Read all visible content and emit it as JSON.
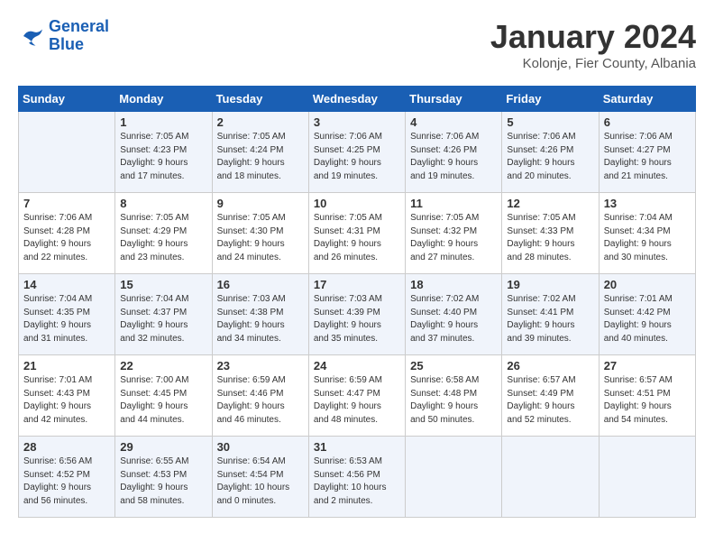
{
  "header": {
    "logo_line1": "General",
    "logo_line2": "Blue",
    "title": "January 2024",
    "subtitle": "Kolonje, Fier County, Albania"
  },
  "days_of_week": [
    "Sunday",
    "Monday",
    "Tuesday",
    "Wednesday",
    "Thursday",
    "Friday",
    "Saturday"
  ],
  "weeks": [
    [
      {
        "day": "",
        "info": ""
      },
      {
        "day": "1",
        "info": "Sunrise: 7:05 AM\nSunset: 4:23 PM\nDaylight: 9 hours\nand 17 minutes."
      },
      {
        "day": "2",
        "info": "Sunrise: 7:05 AM\nSunset: 4:24 PM\nDaylight: 9 hours\nand 18 minutes."
      },
      {
        "day": "3",
        "info": "Sunrise: 7:06 AM\nSunset: 4:25 PM\nDaylight: 9 hours\nand 19 minutes."
      },
      {
        "day": "4",
        "info": "Sunrise: 7:06 AM\nSunset: 4:26 PM\nDaylight: 9 hours\nand 19 minutes."
      },
      {
        "day": "5",
        "info": "Sunrise: 7:06 AM\nSunset: 4:26 PM\nDaylight: 9 hours\nand 20 minutes."
      },
      {
        "day": "6",
        "info": "Sunrise: 7:06 AM\nSunset: 4:27 PM\nDaylight: 9 hours\nand 21 minutes."
      }
    ],
    [
      {
        "day": "7",
        "info": "Sunrise: 7:06 AM\nSunset: 4:28 PM\nDaylight: 9 hours\nand 22 minutes."
      },
      {
        "day": "8",
        "info": "Sunrise: 7:05 AM\nSunset: 4:29 PM\nDaylight: 9 hours\nand 23 minutes."
      },
      {
        "day": "9",
        "info": "Sunrise: 7:05 AM\nSunset: 4:30 PM\nDaylight: 9 hours\nand 24 minutes."
      },
      {
        "day": "10",
        "info": "Sunrise: 7:05 AM\nSunset: 4:31 PM\nDaylight: 9 hours\nand 26 minutes."
      },
      {
        "day": "11",
        "info": "Sunrise: 7:05 AM\nSunset: 4:32 PM\nDaylight: 9 hours\nand 27 minutes."
      },
      {
        "day": "12",
        "info": "Sunrise: 7:05 AM\nSunset: 4:33 PM\nDaylight: 9 hours\nand 28 minutes."
      },
      {
        "day": "13",
        "info": "Sunrise: 7:04 AM\nSunset: 4:34 PM\nDaylight: 9 hours\nand 30 minutes."
      }
    ],
    [
      {
        "day": "14",
        "info": "Sunrise: 7:04 AM\nSunset: 4:35 PM\nDaylight: 9 hours\nand 31 minutes."
      },
      {
        "day": "15",
        "info": "Sunrise: 7:04 AM\nSunset: 4:37 PM\nDaylight: 9 hours\nand 32 minutes."
      },
      {
        "day": "16",
        "info": "Sunrise: 7:03 AM\nSunset: 4:38 PM\nDaylight: 9 hours\nand 34 minutes."
      },
      {
        "day": "17",
        "info": "Sunrise: 7:03 AM\nSunset: 4:39 PM\nDaylight: 9 hours\nand 35 minutes."
      },
      {
        "day": "18",
        "info": "Sunrise: 7:02 AM\nSunset: 4:40 PM\nDaylight: 9 hours\nand 37 minutes."
      },
      {
        "day": "19",
        "info": "Sunrise: 7:02 AM\nSunset: 4:41 PM\nDaylight: 9 hours\nand 39 minutes."
      },
      {
        "day": "20",
        "info": "Sunrise: 7:01 AM\nSunset: 4:42 PM\nDaylight: 9 hours\nand 40 minutes."
      }
    ],
    [
      {
        "day": "21",
        "info": "Sunrise: 7:01 AM\nSunset: 4:43 PM\nDaylight: 9 hours\nand 42 minutes."
      },
      {
        "day": "22",
        "info": "Sunrise: 7:00 AM\nSunset: 4:45 PM\nDaylight: 9 hours\nand 44 minutes."
      },
      {
        "day": "23",
        "info": "Sunrise: 6:59 AM\nSunset: 4:46 PM\nDaylight: 9 hours\nand 46 minutes."
      },
      {
        "day": "24",
        "info": "Sunrise: 6:59 AM\nSunset: 4:47 PM\nDaylight: 9 hours\nand 48 minutes."
      },
      {
        "day": "25",
        "info": "Sunrise: 6:58 AM\nSunset: 4:48 PM\nDaylight: 9 hours\nand 50 minutes."
      },
      {
        "day": "26",
        "info": "Sunrise: 6:57 AM\nSunset: 4:49 PM\nDaylight: 9 hours\nand 52 minutes."
      },
      {
        "day": "27",
        "info": "Sunrise: 6:57 AM\nSunset: 4:51 PM\nDaylight: 9 hours\nand 54 minutes."
      }
    ],
    [
      {
        "day": "28",
        "info": "Sunrise: 6:56 AM\nSunset: 4:52 PM\nDaylight: 9 hours\nand 56 minutes."
      },
      {
        "day": "29",
        "info": "Sunrise: 6:55 AM\nSunset: 4:53 PM\nDaylight: 9 hours\nand 58 minutes."
      },
      {
        "day": "30",
        "info": "Sunrise: 6:54 AM\nSunset: 4:54 PM\nDaylight: 10 hours\nand 0 minutes."
      },
      {
        "day": "31",
        "info": "Sunrise: 6:53 AM\nSunset: 4:56 PM\nDaylight: 10 hours\nand 2 minutes."
      },
      {
        "day": "",
        "info": ""
      },
      {
        "day": "",
        "info": ""
      },
      {
        "day": "",
        "info": ""
      }
    ]
  ]
}
